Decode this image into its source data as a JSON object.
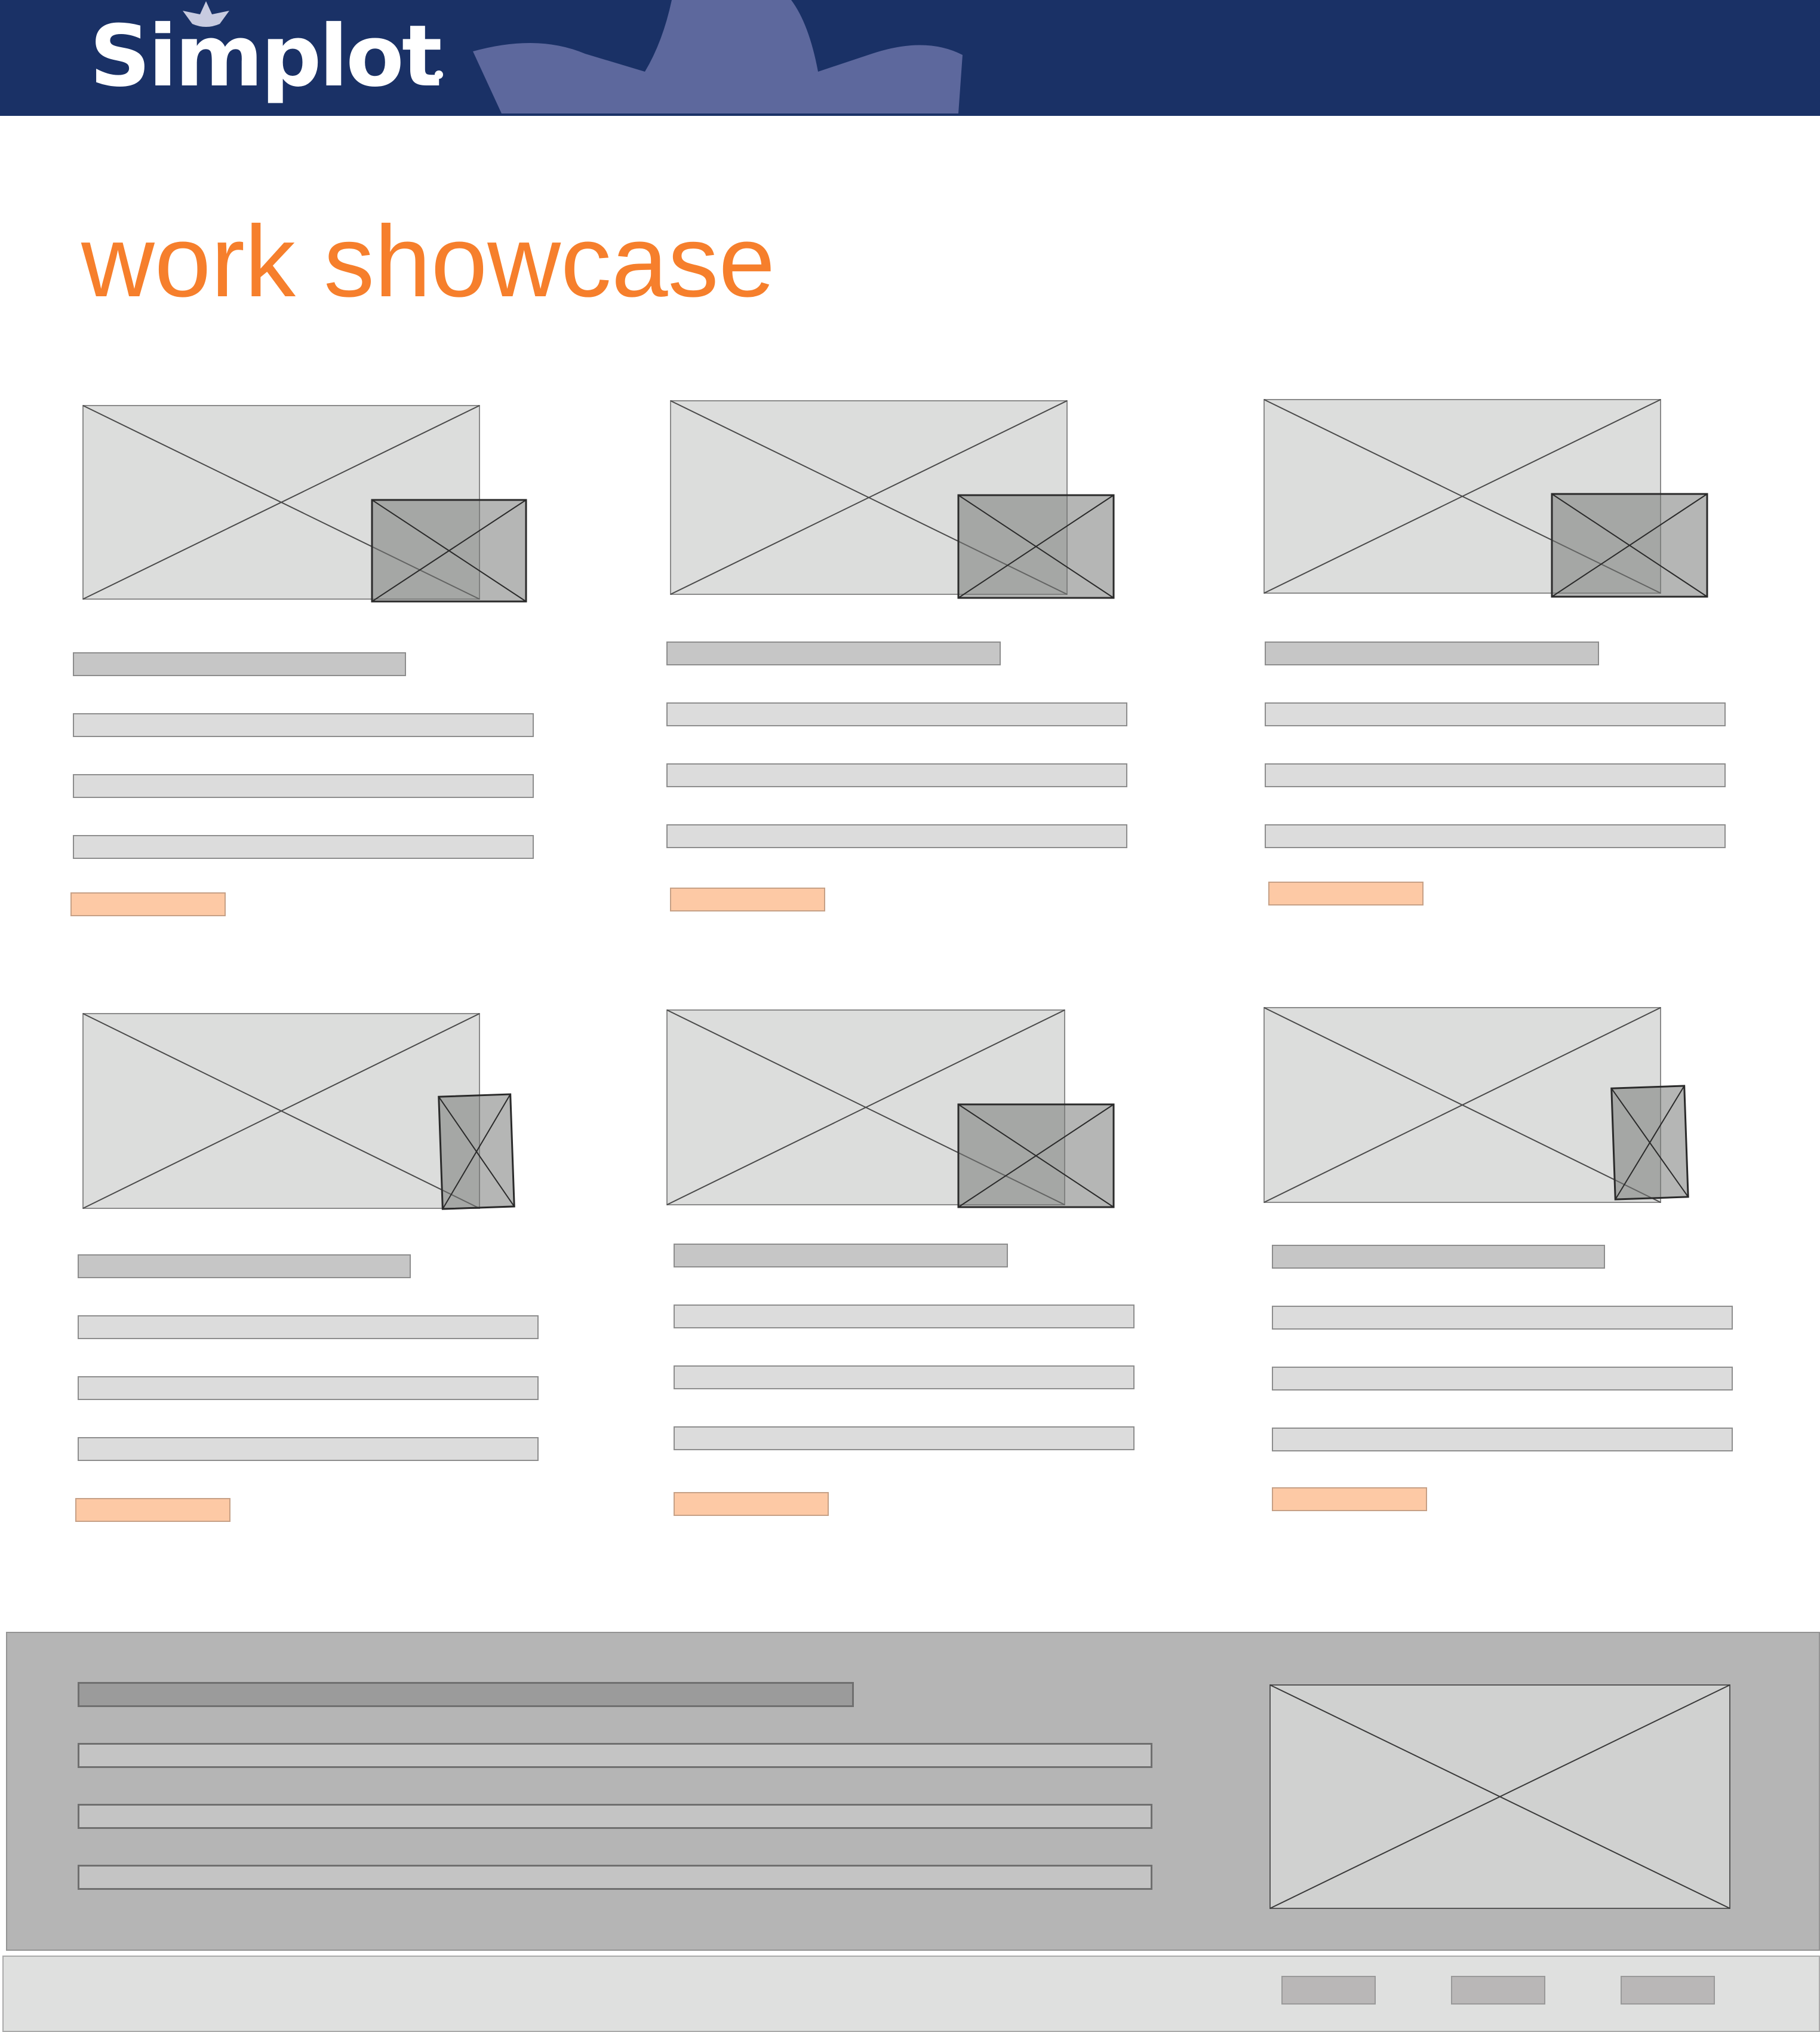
{
  "brand": {
    "logo_text": "Simplot",
    "colors": {
      "header_bg": "#1a3166",
      "header_decor": "#5d689d",
      "accent": "#f67f2c"
    }
  },
  "page": {
    "title": "work showcase"
  },
  "icons": {
    "image_placeholder": "image-placeholder-icon",
    "thumbnail_placeholder": "thumbnail-placeholder-icon"
  }
}
